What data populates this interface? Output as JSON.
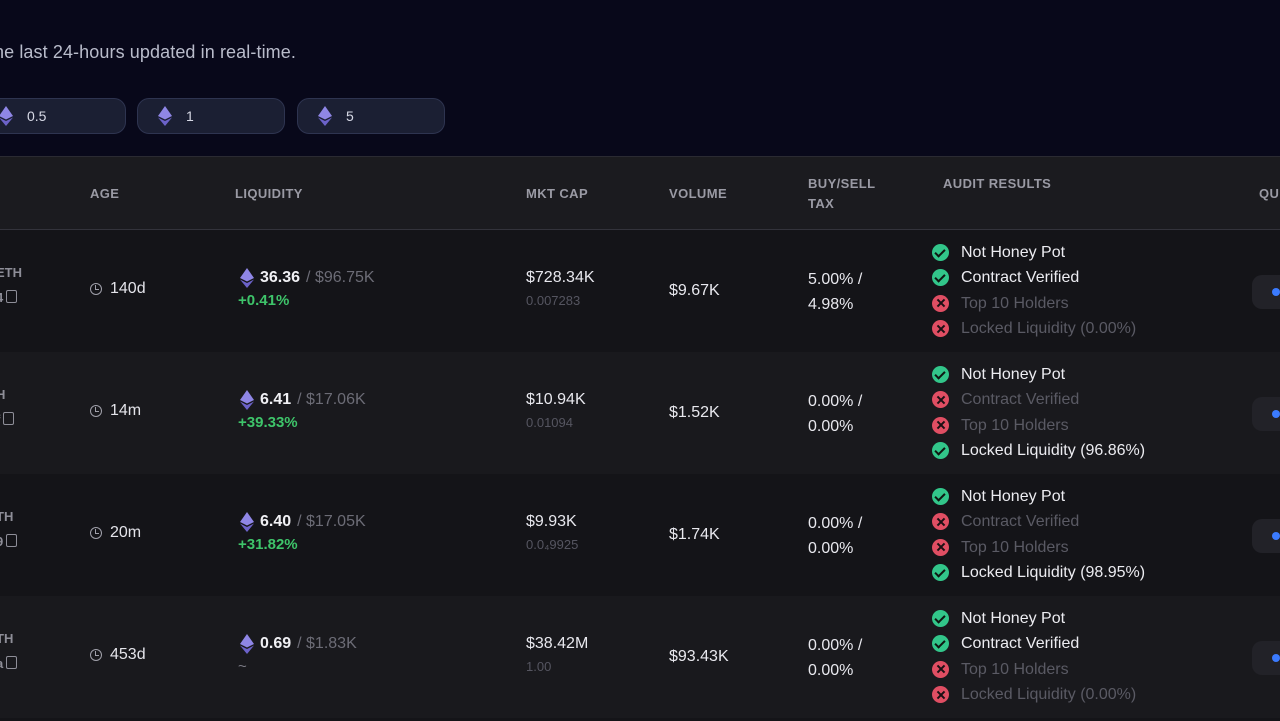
{
  "subtitle": "he last 24-hours updated in real-time.",
  "amount_pills": [
    "0.5",
    "1",
    "5"
  ],
  "columns": {
    "age": "AGE",
    "liquidity": "LIQUIDITY",
    "mkt_cap": "MKT CAP",
    "volume": "VOLUME",
    "tax_line1": "BUY/SELL",
    "tax_line2": "TAX",
    "audit": "AUDIT RESULTS",
    "quick": "QU"
  },
  "audit_labels": [
    "Not Honey Pot",
    "Contract Verified",
    "Top 10 Holders"
  ],
  "rows": [
    {
      "pair_frag": "ETH",
      "addr_frag": "4",
      "age": "140d",
      "liq_eth": "36.36",
      "liq_usd": "/ $96.75K",
      "liq_change": "+0.41%",
      "mkt_cap": "$728.34K",
      "price": "0.007283",
      "volume": "$9.67K",
      "buy_tax": "5.00% /",
      "sell_tax": "4.98%",
      "locked_label": "Locked Liquidity (0.00%)",
      "checks": [
        true,
        true,
        false,
        false
      ]
    },
    {
      "pair_frag": "H",
      "addr_frag": "f",
      "age": "14m",
      "liq_eth": "6.41",
      "liq_usd": "/ $17.06K",
      "liq_change": "+39.33%",
      "mkt_cap": "$10.94K",
      "price": "0.01094",
      "volume": "$1.52K",
      "buy_tax": "0.00% /",
      "sell_tax": "0.00%",
      "locked_label": "Locked Liquidity (96.86%)",
      "checks": [
        true,
        false,
        false,
        true
      ]
    },
    {
      "pair_frag": "TH",
      "addr_frag": "9",
      "age": "20m",
      "liq_eth": "6.40",
      "liq_usd": "/ $17.05K",
      "liq_change": "+31.82%",
      "mkt_cap": "$9.93K",
      "price": "0.0₄9925",
      "volume": "$1.74K",
      "buy_tax": "0.00% /",
      "sell_tax": "0.00%",
      "locked_label": "Locked Liquidity (98.95%)",
      "checks": [
        true,
        false,
        false,
        true
      ]
    },
    {
      "pair_frag": "TH",
      "addr_frag": "a",
      "age": "453d",
      "liq_eth": "0.69",
      "liq_usd": "/ $1.83K",
      "liq_change": "~",
      "mkt_cap": "$38.42M",
      "price": "1.00",
      "volume": "$93.43K",
      "buy_tax": "0.00% /",
      "sell_tax": "0.00%",
      "locked_label": "Locked Liquidity (0.00%)",
      "checks": [
        true,
        true,
        false,
        false
      ]
    }
  ],
  "colors": {
    "pass": "#32c68a",
    "fail": "#e04e63",
    "positive_change": "#3ec46a",
    "quick_buy_accent": "#3b7bff"
  }
}
